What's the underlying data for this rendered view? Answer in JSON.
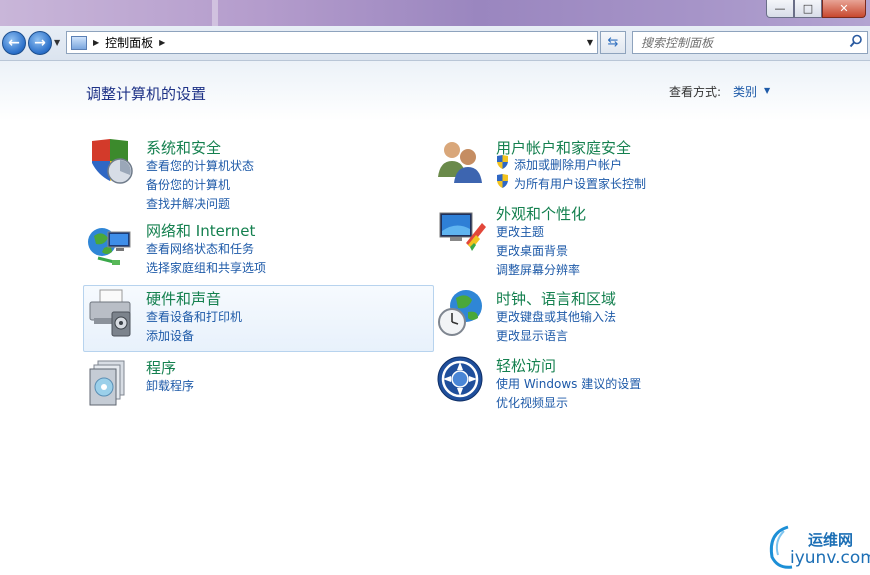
{
  "window": {
    "minimize": "—",
    "maximize": "□",
    "close": "✕"
  },
  "address": {
    "crumb": "控制面板",
    "search_placeholder": "搜索控制面板"
  },
  "content": {
    "page_title": "调整计算机的设置",
    "view_by_label": "查看方式:",
    "view_by_value": "类别"
  },
  "categories": {
    "system": {
      "title": "系统和安全",
      "links": [
        "查看您的计算机状态",
        "备份您的计算机",
        "查找并解决问题"
      ]
    },
    "network": {
      "title": "网络和 Internet",
      "links": [
        "查看网络状态和任务",
        "选择家庭组和共享选项"
      ]
    },
    "hardware": {
      "title": "硬件和声音",
      "links": [
        "查看设备和打印机",
        "添加设备"
      ]
    },
    "programs": {
      "title": "程序",
      "links": [
        "卸载程序"
      ]
    },
    "users": {
      "title": "用户帐户和家庭安全",
      "links": [
        "添加或删除用户帐户",
        "为所有用户设置家长控制"
      ]
    },
    "appearance": {
      "title": "外观和个性化",
      "links": [
        "更改主题",
        "更改桌面背景",
        "调整屏幕分辨率"
      ]
    },
    "clock": {
      "title": "时钟、语言和区域",
      "links": [
        "更改键盘或其他输入法",
        "更改显示语言"
      ]
    },
    "ease": {
      "title": "轻松访问",
      "links": [
        "使用 Windows 建议的设置",
        "优化视频显示"
      ]
    }
  },
  "watermark": {
    "line1": "运维网",
    "line2": "iyunv.com"
  }
}
